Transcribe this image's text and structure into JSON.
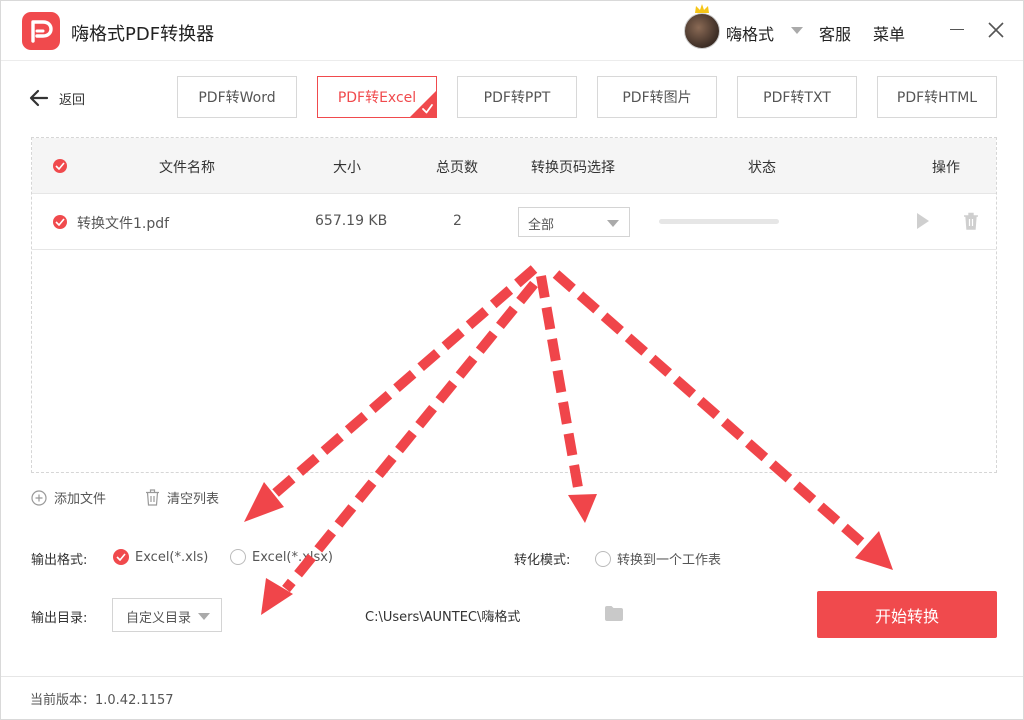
{
  "app": {
    "title": "嗨格式PDF转换器",
    "user_name": "嗨格式",
    "service_label": "客服",
    "menu_label": "菜单"
  },
  "nav": {
    "back_label": "返回",
    "tabs": [
      {
        "label": "PDF转Word",
        "active": false
      },
      {
        "label": "PDF转Excel",
        "active": true
      },
      {
        "label": "PDF转PPT",
        "active": false
      },
      {
        "label": "PDF转图片",
        "active": false
      },
      {
        "label": "PDF转TXT",
        "active": false
      },
      {
        "label": "PDF转HTML",
        "active": false
      }
    ]
  },
  "table": {
    "headers": {
      "name": "文件名称",
      "size": "大小",
      "pages": "总页数",
      "range": "转换页码选择",
      "status": "状态",
      "action": "操作"
    },
    "rows": [
      {
        "name": "转换文件1.pdf",
        "size": "657.19 KB",
        "pages": "2",
        "range": "全部",
        "progress": 0,
        "checked": true
      }
    ]
  },
  "actions": {
    "add_file": "添加文件",
    "clear_list": "清空列表"
  },
  "output": {
    "format_label": "输出格式:",
    "format_options": [
      {
        "label": "Excel(*.xls)",
        "selected": true
      },
      {
        "label": "Excel(*.xlsx)",
        "selected": false
      }
    ],
    "mode_label": "转化模式:",
    "mode_option": {
      "label": "转换到一个工作表",
      "selected": false
    },
    "dir_label": "输出目录:",
    "dir_select": "自定义目录",
    "dir_path": "C:\\Users\\AUNTEC\\嗨格式",
    "start_label": "开始转换"
  },
  "footer": {
    "version": "当前版本：1.0.42.1157"
  },
  "colors": {
    "accent": "#f04a4d",
    "arrow": "#f0454a"
  }
}
